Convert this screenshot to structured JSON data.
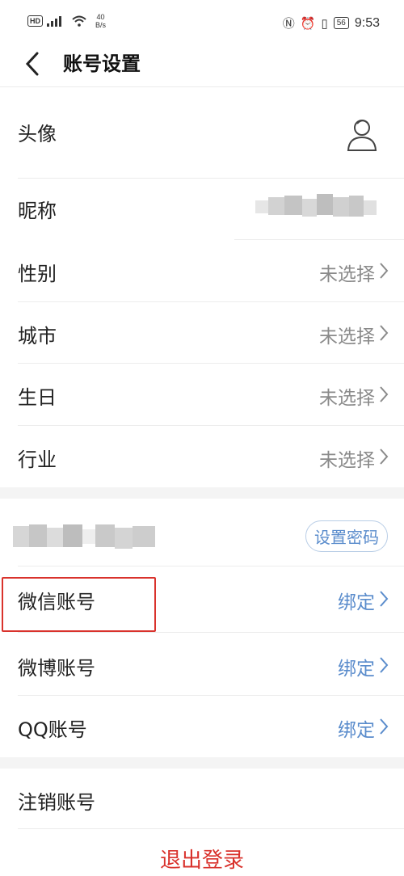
{
  "status_bar": {
    "hd": "HD",
    "signal": "4G",
    "speed_value": "40",
    "speed_unit": "B/s",
    "battery": "56",
    "time": "9:53"
  },
  "header": {
    "title": "账号设置"
  },
  "profile": {
    "avatar_label": "头像",
    "nickname_label": "昵称",
    "gender_label": "性别",
    "gender_value": "未选择",
    "city_label": "城市",
    "city_value": "未选择",
    "birthday_label": "生日",
    "birthday_value": "未选择",
    "industry_label": "行业",
    "industry_value": "未选择"
  },
  "account": {
    "set_password_label": "设置密码",
    "wechat_label": "微信账号",
    "wechat_value": "绑定",
    "weibo_label": "微博账号",
    "weibo_value": "绑定",
    "qq_label": "QQ账号",
    "qq_value": "绑定"
  },
  "footer": {
    "cancel_account_label": "注销账号",
    "logout_label": "退出登录"
  },
  "colors": {
    "link_blue": "#5a8ccc",
    "danger_red": "#d9322c",
    "muted_gray": "#8a8a8a"
  }
}
